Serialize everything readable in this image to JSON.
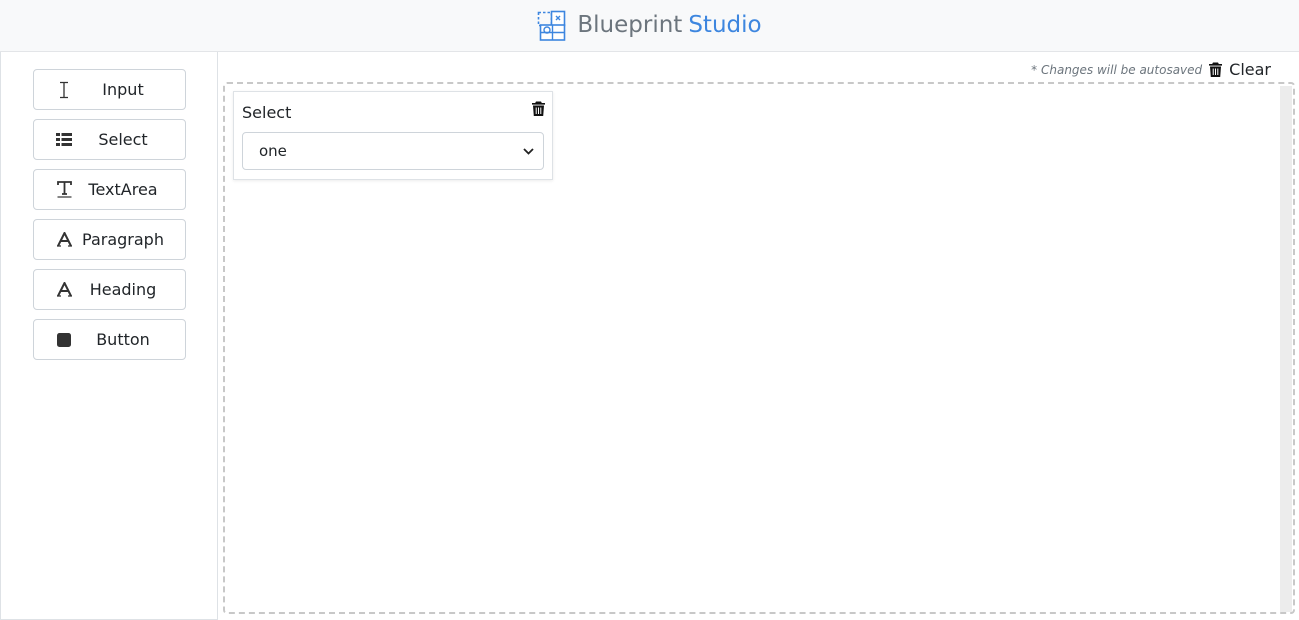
{
  "app": {
    "brand_main": "Blueprint",
    "brand_accent": "Studio",
    "accent_color": "#3d86df",
    "logo_icon": "blueprint-logo-icon"
  },
  "toolbox": {
    "items": [
      {
        "label": "Input",
        "icon": "text-cursor-icon"
      },
      {
        "label": "Select",
        "icon": "list-icon"
      },
      {
        "label": "TextArea",
        "icon": "text-format-icon"
      },
      {
        "label": "Paragraph",
        "icon": "font-icon"
      },
      {
        "label": "Heading",
        "icon": "font-icon"
      },
      {
        "label": "Button",
        "icon": "square-icon"
      }
    ]
  },
  "workspace": {
    "autosave_note": "* Changes will be autosaved",
    "clear_label": "Clear",
    "widgets": [
      {
        "type": "select",
        "label": "Select",
        "selected_value": "one"
      }
    ]
  }
}
